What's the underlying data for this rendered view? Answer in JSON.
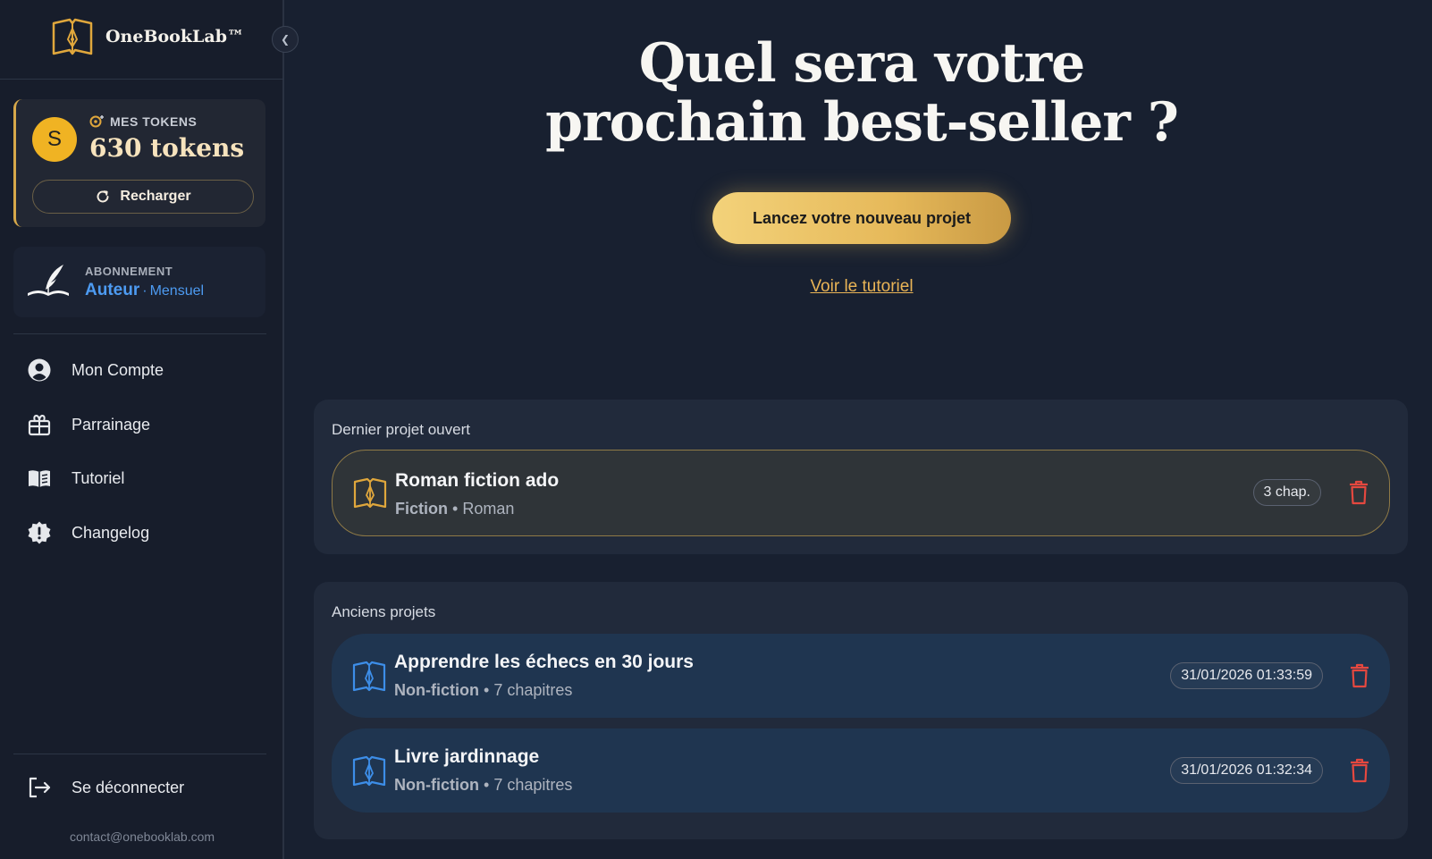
{
  "brand": {
    "name": "OneBookLab™",
    "logo_icon": "open-book-pen-icon",
    "accent": "#e0a73c"
  },
  "sidebar": {
    "collapse_icon": "chevron-left-icon",
    "tokens": {
      "avatar_initial": "S",
      "label": "MES TOKENS",
      "value": "630 tokens",
      "recharge_label": "Recharger"
    },
    "subscription": {
      "label": "ABONNEMENT",
      "plan": "Auteur",
      "separator": "·",
      "period": "Mensuel",
      "plan_color": "#4d9bf2"
    },
    "nav": [
      {
        "label": "Mon Compte",
        "icon": "user-circle-icon"
      },
      {
        "label": "Parrainage",
        "icon": "gift-icon"
      },
      {
        "label": "Tutoriel",
        "icon": "book-open-icon"
      },
      {
        "label": "Changelog",
        "icon": "alert-badge-icon"
      }
    ],
    "logout_label": "Se déconnecter",
    "contact": "contact@onebooklab.com"
  },
  "hero": {
    "title_line1": "Quel sera votre",
    "title_line2": "prochain best-seller ?",
    "cta_label": "Lancez votre nouveau projet",
    "tutorial_link": "Voir le tutoriel"
  },
  "last_project": {
    "section_title": "Dernier projet ouvert",
    "name": "Roman fiction ado",
    "category": "Fiction",
    "dot": "•",
    "subtype": "Roman",
    "badge": "3 chap."
  },
  "old_projects": {
    "section_title": "Anciens projets",
    "items": [
      {
        "name": "Apprendre les échecs en 30 jours",
        "category": "Non-fiction",
        "dot": "•",
        "detail": "7 chapitres",
        "date": "31/01/2026 01:33:59"
      },
      {
        "name": "Livre jardinnage",
        "category": "Non-fiction",
        "dot": "•",
        "detail": "7 chapitres",
        "date": "31/01/2026 01:32:34"
      }
    ]
  }
}
